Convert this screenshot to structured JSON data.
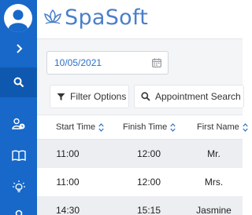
{
  "app": {
    "brand": "SpaSoft",
    "accent": "#1768c8",
    "brand_color": "#4a7fc9"
  },
  "sidebar": {
    "items": [
      {
        "name": "expand",
        "icon": "chevron-right-icon"
      },
      {
        "name": "search",
        "icon": "search-icon",
        "active": true
      },
      {
        "name": "customers",
        "icon": "user-clock-icon"
      },
      {
        "name": "catalog",
        "icon": "book-icon"
      },
      {
        "name": "ideas",
        "icon": "lightbulb-icon"
      }
    ]
  },
  "filters": {
    "date_value": "10/05/2021",
    "filter_options_label": "Filter Options",
    "appointment_search_label": "Appointment Search"
  },
  "table": {
    "columns": [
      "Start Time",
      "Finish Time",
      "First Name"
    ],
    "rows": [
      [
        "11:00",
        "12:00",
        "Mr."
      ],
      [
        "11:00",
        "12:00",
        "Mrs."
      ],
      [
        "14:30",
        "15:15",
        "Jasmine"
      ]
    ]
  }
}
